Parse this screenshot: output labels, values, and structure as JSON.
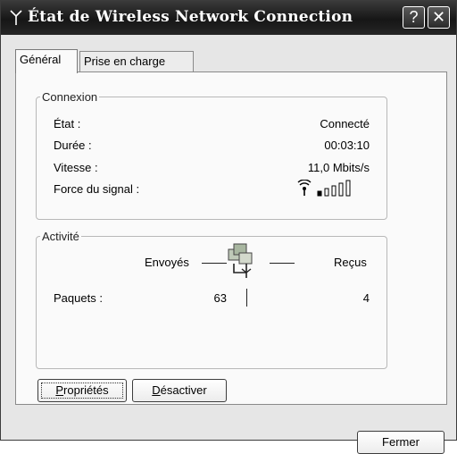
{
  "window": {
    "title": "État de Wireless Network Connection"
  },
  "titlebar_buttons": {
    "help": "?",
    "close": "✕"
  },
  "tabs": [
    {
      "label": "Général"
    },
    {
      "label": "Prise en charge"
    }
  ],
  "connexion": {
    "legend": "Connexion",
    "rows": [
      {
        "label": "État :",
        "value": "Connecté"
      },
      {
        "label": "Durée :",
        "value": "00:03:10"
      },
      {
        "label": "Vitesse :",
        "value": "11,0 Mbits/s"
      },
      {
        "label": "Force du signal :",
        "value": ""
      }
    ],
    "signal_strength_bars": 1,
    "signal_total_bars": 5
  },
  "activite": {
    "legend": "Activité",
    "sent_label": "Envoyés",
    "received_label": "Reçus",
    "packets_label": "Paquets :",
    "packets_sent": "63",
    "packets_received": "4"
  },
  "buttons": {
    "properties_underline": "P",
    "properties_rest": "ropriétés",
    "disable_underline": "D",
    "disable_rest": "ésactiver",
    "close": "Fermer"
  },
  "icons": {
    "title": "antenna-icon",
    "signal": "signal-strength-icon",
    "activity": "network-computers-icon"
  }
}
